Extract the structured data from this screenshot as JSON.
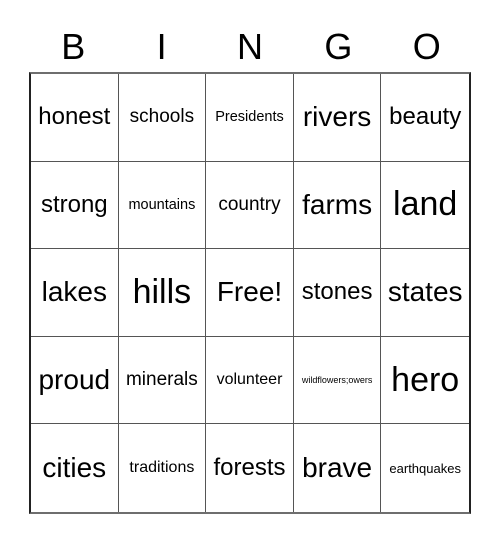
{
  "header": [
    "B",
    "I",
    "N",
    "G",
    "O"
  ],
  "cells": [
    {
      "text": "honest",
      "size": "m"
    },
    {
      "text": "schools",
      "size": "s"
    },
    {
      "text": "Presidents",
      "size": "xxs"
    },
    {
      "text": "rivers",
      "size": "l"
    },
    {
      "text": "beauty",
      "size": "m"
    },
    {
      "text": "strong",
      "size": "m"
    },
    {
      "text": "mountains",
      "size": "xxs"
    },
    {
      "text": "country",
      "size": "s"
    },
    {
      "text": "farms",
      "size": "l"
    },
    {
      "text": "land",
      "size": "xl"
    },
    {
      "text": "lakes",
      "size": "l"
    },
    {
      "text": "hills",
      "size": "xl"
    },
    {
      "text": "Free!",
      "size": "l"
    },
    {
      "text": "stones",
      "size": "m"
    },
    {
      "text": "states",
      "size": "l"
    },
    {
      "text": "proud",
      "size": "l"
    },
    {
      "text": "minerals",
      "size": "s"
    },
    {
      "text": "volunteer",
      "size": "xs"
    },
    {
      "text": "wildflowers;owers",
      "size": "micro"
    },
    {
      "text": "hero",
      "size": "xl"
    },
    {
      "text": "cities",
      "size": "l"
    },
    {
      "text": "traditions",
      "size": "xs"
    },
    {
      "text": "forests",
      "size": "m"
    },
    {
      "text": "brave",
      "size": "l"
    },
    {
      "text": "earthquakes",
      "size": "tiny"
    }
  ]
}
